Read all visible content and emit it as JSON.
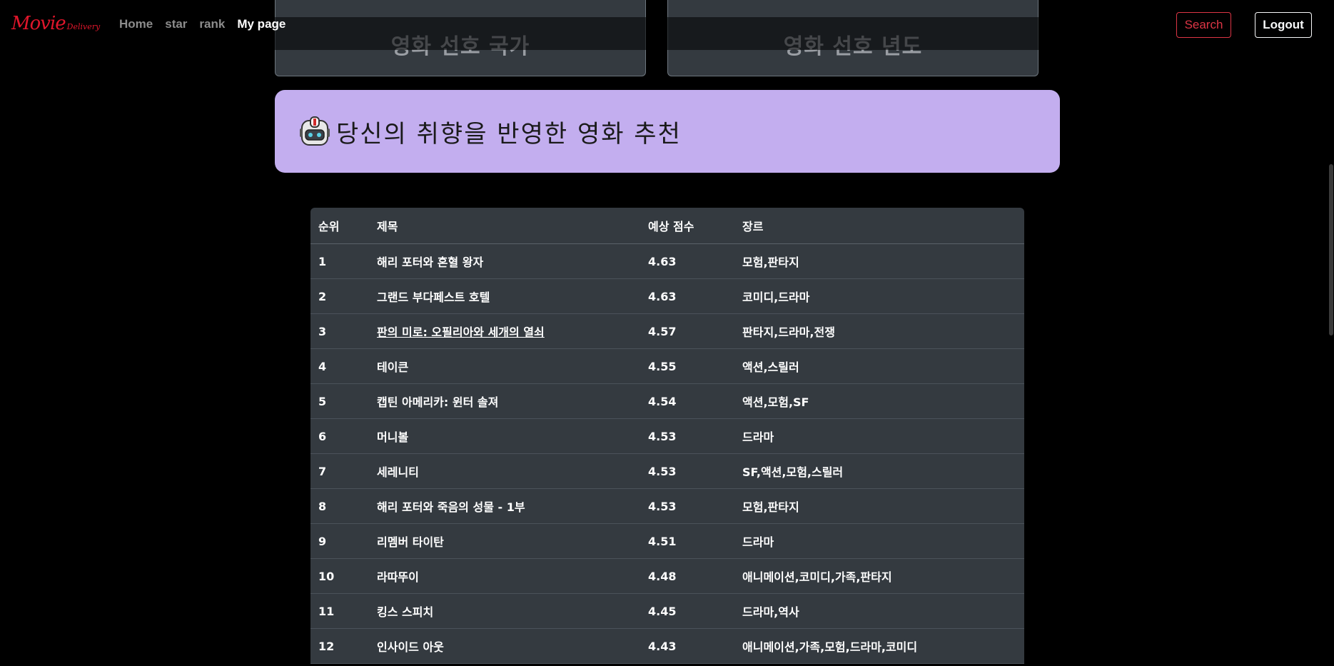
{
  "navbar": {
    "brand": "Movie",
    "brand_sub": "Delivery",
    "links": [
      {
        "label": "Home",
        "active": false
      },
      {
        "label": "star",
        "active": false
      },
      {
        "label": "rank",
        "active": false
      },
      {
        "label": "My page",
        "active": true
      }
    ],
    "search_label": "Search",
    "logout_label": "Logout"
  },
  "pref_cards": {
    "country_title": "영화 선호 국가",
    "year_title": "영화 선호 년도"
  },
  "banner": {
    "icon": "robot-icon",
    "title": "당신의 취향을 반영한 영화 추천"
  },
  "table": {
    "headers": [
      "순위",
      "제목",
      "예상 점수",
      "장르"
    ],
    "rows": [
      {
        "rank": "1",
        "title": "해리 포터와 혼혈 왕자",
        "score": "4.63",
        "genre": "모험,판타지"
      },
      {
        "rank": "2",
        "title": "그랜드 부다페스트 호텔",
        "score": "4.63",
        "genre": "코미디,드라마"
      },
      {
        "rank": "3",
        "title": "판의 미로: 오필리아와 세개의 열쇠",
        "score": "4.57",
        "genre": "판타지,드라마,전쟁"
      },
      {
        "rank": "4",
        "title": "테이큰",
        "score": "4.55",
        "genre": "액션,스릴러"
      },
      {
        "rank": "5",
        "title": "캡틴 아메리카: 윈터 솔져",
        "score": "4.54",
        "genre": "액션,모험,SF"
      },
      {
        "rank": "6",
        "title": "머니볼",
        "score": "4.53",
        "genre": "드라마"
      },
      {
        "rank": "7",
        "title": "세레니티",
        "score": "4.53",
        "genre": "SF,액션,모험,스릴러"
      },
      {
        "rank": "8",
        "title": "해리 포터와 죽음의 성물 - 1부",
        "score": "4.53",
        "genre": "모험,판타지"
      },
      {
        "rank": "9",
        "title": "리멤버 타이탄",
        "score": "4.51",
        "genre": "드라마"
      },
      {
        "rank": "10",
        "title": "라따뚜이",
        "score": "4.48",
        "genre": "애니메이션,코미디,가족,판타지"
      },
      {
        "rank": "11",
        "title": "킹스 스피치",
        "score": "4.45",
        "genre": "드라마,역사"
      },
      {
        "rank": "12",
        "title": "인사이드 아웃",
        "score": "4.43",
        "genre": "애니메이션,가족,모험,드라마,코미디"
      }
    ]
  },
  "colors": {
    "brand": "#e0162b",
    "banner_bg": "#c3aeef",
    "table_bg": "#343a40",
    "search_accent": "#dc3545"
  }
}
